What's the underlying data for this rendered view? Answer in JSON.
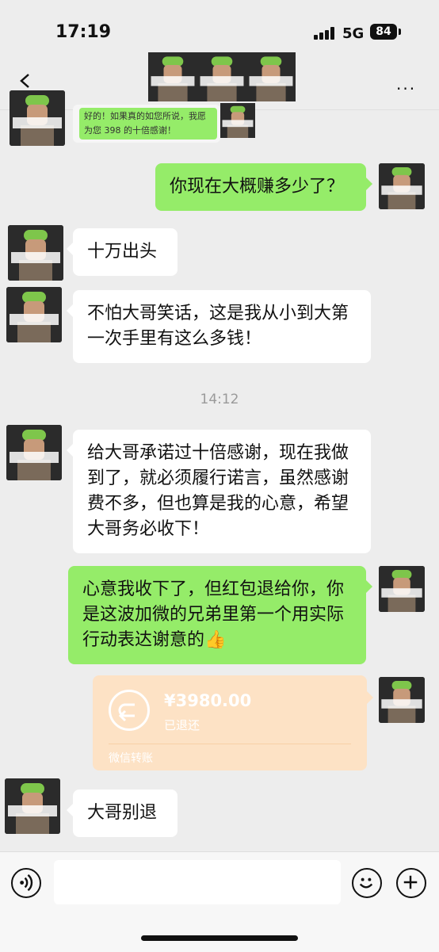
{
  "status_bar": {
    "time": "17:19",
    "network": "5G",
    "battery": "84"
  },
  "nav": {
    "back_label": "<",
    "more_label": "..."
  },
  "quoted_message": {
    "text": "好的！如果真的如您所说，我愿为您 398 的十倍感谢！"
  },
  "messages": [
    {
      "side": "out",
      "text": "你现在大概赚多少了？"
    },
    {
      "side": "in",
      "text": "十万出头"
    },
    {
      "side": "in",
      "text": "不怕大哥笑话，这是我从小到大第一次手里有这么多钱！"
    },
    {
      "side": "in",
      "text": "给大哥承诺过十倍感谢，现在我做到了，就必须履行诺言，虽然感谢费不多，但也算是我的心意，希望大哥务必收下！"
    },
    {
      "side": "out",
      "text": "心意我收下了，但红包退给你，你是这波加微的兄弟里第一个用实际行动表达谢意的👍"
    },
    {
      "side": "in",
      "text": "大哥别退"
    }
  ],
  "timestamp": "14:12",
  "transfer": {
    "amount": "¥3980.00",
    "status": "已退还",
    "footer": "微信转账"
  },
  "input": {
    "placeholder": ""
  },
  "colors": {
    "background": "#ededed",
    "out_bubble": "#95ec69",
    "in_bubble": "#ffffff",
    "transfer_card": "#fde2c5"
  }
}
